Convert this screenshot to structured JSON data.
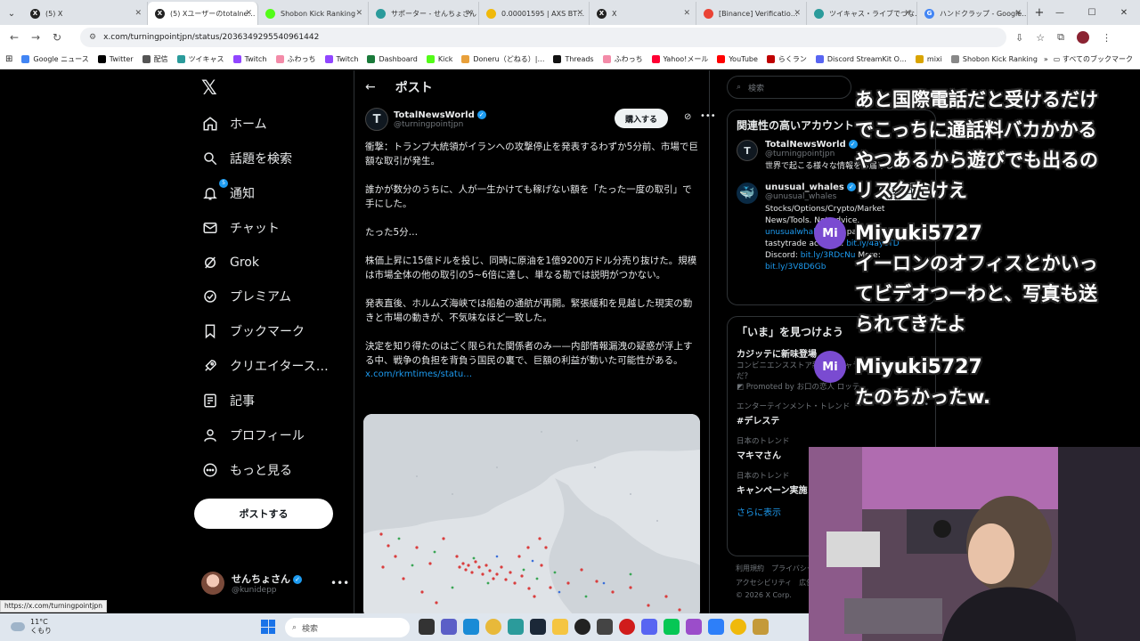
{
  "browser": {
    "tabs": [
      {
        "title": "(5) X",
        "fav": "x-icon"
      },
      {
        "title": "(5) Xユーザーのtotalne…",
        "fav": "x-icon",
        "active": true
      },
      {
        "title": "Shobon Kick Ranking",
        "fav": "kick-icon"
      },
      {
        "title": "サポーター - せんちょさん",
        "fav": "globe-icon"
      },
      {
        "title": "0.00001595 | AXS BT…",
        "fav": "binance-icon"
      },
      {
        "title": "X",
        "fav": "x-icon"
      },
      {
        "title": "[Binance] Verificatio…",
        "fav": "gmail-icon"
      },
      {
        "title": "ツイキャス・ライブでつな…",
        "fav": "twitcasting-icon"
      },
      {
        "title": "ハンドクラップ - Google…",
        "fav": "google-icon"
      }
    ],
    "url": "x.com/turningpointjpn/status/2036349295540961442",
    "bookmarks": [
      "Google ニュース",
      "Twitter",
      "配信",
      "ツイキャス",
      "Twitch",
      "ふわっち",
      "Twitch",
      "Dashboard",
      "Kick",
      "Doneru（どねる）|…",
      "Threads",
      "ふわっち",
      "Yahoo!メール",
      "YouTube",
      "らくラン",
      "Discord StreamKit O…",
      "mixi",
      "Shobon Kick Ranking"
    ],
    "bookmarks_all": "すべてのブックマーク",
    "status_url": "https://x.com/turningpointjpn"
  },
  "nav": {
    "items": [
      {
        "label": "ホーム",
        "icon": "home-icon"
      },
      {
        "label": "話題を検索",
        "icon": "search-icon"
      },
      {
        "label": "通知",
        "icon": "bell-icon",
        "badge": "5"
      },
      {
        "label": "チャット",
        "icon": "mail-icon"
      },
      {
        "label": "Grok",
        "icon": "grok-icon"
      },
      {
        "label": "プレミアム",
        "icon": "verified-icon"
      },
      {
        "label": "ブックマーク",
        "icon": "bookmark-icon"
      },
      {
        "label": "クリエイタース…",
        "icon": "rocket-icon"
      },
      {
        "label": "記事",
        "icon": "article-icon"
      },
      {
        "label": "プロフィール",
        "icon": "person-icon"
      },
      {
        "label": "もっと見る",
        "icon": "more-circle-icon"
      }
    ],
    "post_button": "ポストする",
    "account": {
      "name": "せんちょさん",
      "handle": "@kunidepp"
    }
  },
  "main": {
    "header": "ポスト",
    "author": {
      "name": "TotalNewsWorld",
      "handle": "@turningpointjpn",
      "avatar_letter": "T"
    },
    "subscribe": "購入する",
    "paragraphs": [
      "衝撃：トランプ大統領がイランへの攻撃停止を発表するわずか5分前、市場で巨額な取引が発生。",
      "誰かが数分のうちに、人が一生かけても稼げない額を「たった一度の取引」で手にした。",
      "たった5分…",
      "株価上昇に15億ドルを投じ、同時に原油を1億9200万ドル分売り抜けた。規模は市場全体の他の取引の5~6倍に達し、単なる勘では説明がつかない。",
      "発表直後、ホルムズ海峡では船舶の通航が再開。緊張緩和を見越した現実の動きと市場の動きが、不気味なほど一致した。",
      "決定を知り得たのはごく限られた関係者のみ——内部情報漏洩の疑惑が浮上する中、戦争の負担を背負う国民の裏で、巨額の利益が動いた可能性がある。"
    ],
    "link": "x.com/rkmtimes/statu…"
  },
  "right": {
    "search_placeholder": "検索",
    "related_title": "関連性の高いアカウント",
    "accounts": [
      {
        "name": "TotalNewsWorld",
        "handle": "@turningpointjpn",
        "bio": "世界で起こる様々な情報をお届けします",
        "avatar": "T"
      },
      {
        "name": "unusual_whales",
        "handle": "@unusual_whales",
        "bio_a": "Stocks/Options/Crypto/Market News/Tools. Not advice.",
        "bio_link1": "unusualwhales.com",
        "bio_b": "partner Open a tastytrade account:",
        "bio_link2": "bit.ly/4aycTD",
        "bio_c": "Discord:",
        "bio_link3": "bit.ly/3RDcNu",
        "bio_d": "More:",
        "bio_link4": "bit.ly/3V8D6Gb",
        "follow": "フォロー"
      }
    ],
    "trends_title": "「いま」を見つけよう",
    "trends": [
      {
        "meta": "",
        "title": "カジッテに新味登場",
        "sub": "コンビニエンスストア新作 新キャラ登場、中の人は誰だ？",
        "promo": "Promoted by お口の恋人 ロッテ"
      },
      {
        "meta": "エンターテインメント・トレンド",
        "title": "#デレステ"
      },
      {
        "meta": "日本のトレンド",
        "title": "マキマさん"
      },
      {
        "meta": "日本のトレンド",
        "title": "キャンペーン実施"
      }
    ],
    "show_more": "さらに表示",
    "footer": [
      "利用規約　プライバシー",
      "アクセシビリティ　広告",
      "© 2026 X Corp."
    ]
  },
  "overlay": {
    "messages": [
      "あと国際電話だと受けるだけ",
      "でこっちに通話料バカかかる",
      "やつあるから遊びでも出るの",
      "リスクたけえ"
    ],
    "msg2_user": "Miyuki5727",
    "msg2_lines": [
      "イーロンのオフィスとかいっ",
      "てビデオつーわと、写真も送",
      "られてきたよ"
    ],
    "msg3_user": "Miyuki5727",
    "msg3_lines": [
      "たのちかったw."
    ],
    "avatar_initials": "Mi"
  },
  "taskbar": {
    "weather_temp": "11°C",
    "weather_desc": "くもり",
    "search": "検索"
  },
  "colors": {
    "accent": "#1d9bf0",
    "bg": "#000000",
    "text": "#e7e9ea",
    "muted": "#71767b"
  }
}
